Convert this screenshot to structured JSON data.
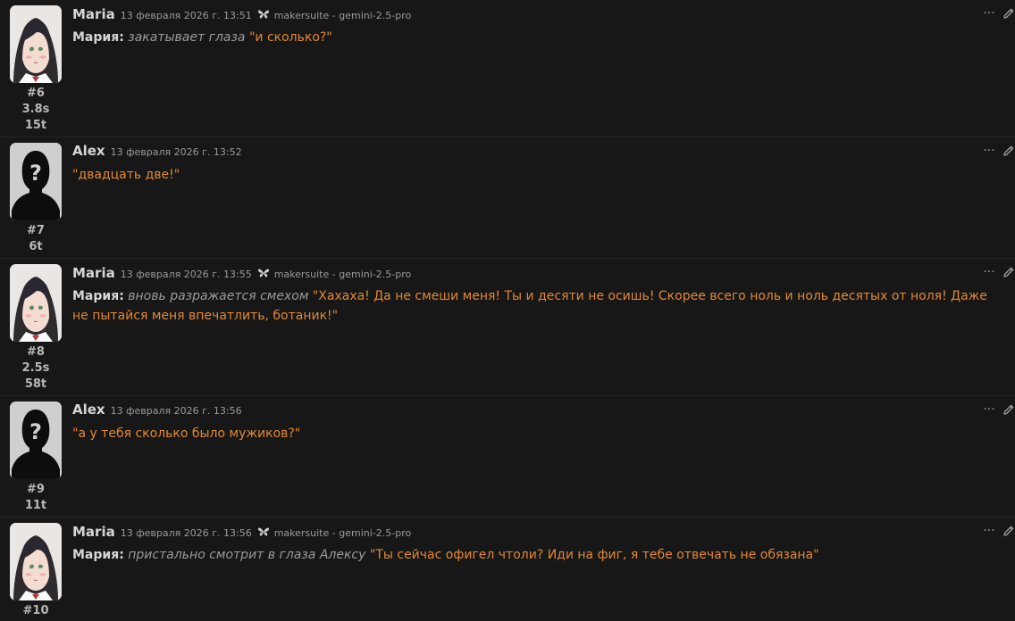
{
  "messages": [
    {
      "id": "6",
      "index_label": "#6",
      "time_label": "3.8s",
      "tokens_label": "15t",
      "author": "Maria",
      "avatar": "maria-portrait",
      "timestamp": "13 февраля 2026 г. 13:51",
      "model_icon": "butterfly-icon",
      "model": "makersuite - gemini-2.5-pro",
      "speaker_label": "Мария:",
      "action": "закатывает глаза",
      "dialogue": "\"и сколько?\""
    },
    {
      "id": "7",
      "index_label": "#7",
      "time_label": "",
      "tokens_label": "6t",
      "author": "Alex",
      "avatar": "unknown-user",
      "timestamp": "13 февраля 2026 г. 13:52",
      "model_icon": "",
      "model": "",
      "speaker_label": "",
      "action": "",
      "dialogue": "\"двадцать две!\""
    },
    {
      "id": "8",
      "index_label": "#8",
      "time_label": "2.5s",
      "tokens_label": "58t",
      "author": "Maria",
      "avatar": "maria-portrait",
      "timestamp": "13 февраля 2026 г. 13:55",
      "model_icon": "butterfly-icon",
      "model": "makersuite - gemini-2.5-pro",
      "speaker_label": "Мария:",
      "action": "вновь разражается смехом",
      "dialogue": "\"Хахаха! Да не смеши меня! Ты и десяти не осишь! Скорее всего ноль и ноль десятых от ноля! Даже не пытайся меня впечатлить, ботаник!\""
    },
    {
      "id": "9",
      "index_label": "#9",
      "time_label": "",
      "tokens_label": "11t",
      "author": "Alex",
      "avatar": "unknown-user",
      "timestamp": "13 февраля 2026 г. 13:56",
      "model_icon": "",
      "model": "",
      "speaker_label": "",
      "action": "",
      "dialogue": "\"а у тебя сколько было мужиков?\""
    },
    {
      "id": "10",
      "index_label": "#10",
      "time_label": "",
      "tokens_label": "",
      "author": "Maria",
      "avatar": "maria-portrait",
      "timestamp": "13 февраля 2026 г. 13:56",
      "model_icon": "butterfly-icon",
      "model": "makersuite - gemini-2.5-pro",
      "speaker_label": "Мария:",
      "action": "пристально смотрит в глаза Алексу",
      "dialogue": "\"Ты сейчас офигел чтоли? Иди на фиг, я тебе отвечать не обязана\""
    }
  ],
  "ui": {
    "more_label": "···",
    "more_icon": "ellipsis-icon",
    "edit_icon": "pencil-icon"
  },
  "colors": {
    "background": "#171717",
    "dialogue": "#e28834",
    "action": "#9a9a9a",
    "name": "#d6d6d6"
  }
}
